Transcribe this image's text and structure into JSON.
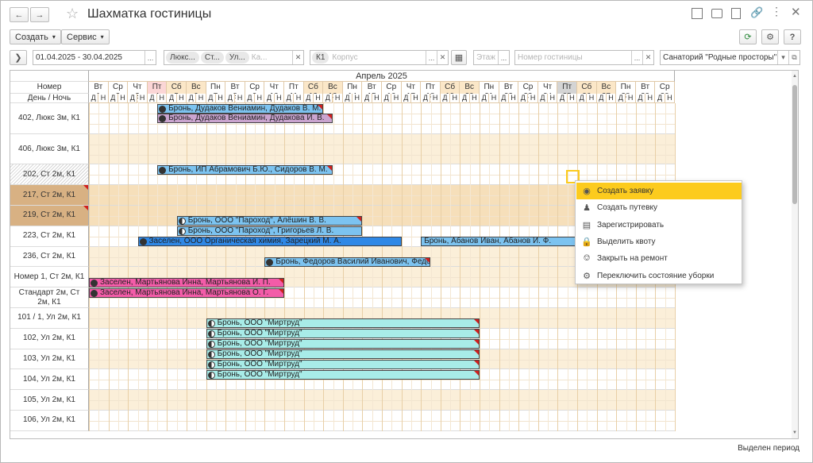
{
  "window": {
    "title": "Шахматка гостиницы"
  },
  "toolbar": {
    "create_label": "Создать",
    "service_label": "Сервис"
  },
  "filters": {
    "period": "01.04.2025 - 30.04.2025",
    "room_types": [
      "Люкс...",
      "Ст...",
      "Ул...",
      "Ка..."
    ],
    "building": {
      "value": "К1",
      "placeholder": "Корпус"
    },
    "floor_placeholder": "Этаж",
    "room_placeholder": "Номер гостиницы",
    "sanatorium": "Санаторий \"Родные просторы\""
  },
  "calendar": {
    "month": "Апрель 2025",
    "room_header": "Номер",
    "daynight_header": "День / Ночь",
    "day_letter": "Д",
    "night_letter": "Н",
    "days": [
      {
        "w": "Вт",
        "d": "1",
        "k": "n"
      },
      {
        "w": "Ср",
        "d": "2",
        "k": "n"
      },
      {
        "w": "Чт",
        "d": "3",
        "k": "n"
      },
      {
        "w": "Пт",
        "d": "4",
        "k": "h"
      },
      {
        "w": "Сб",
        "d": "5",
        "k": "we"
      },
      {
        "w": "Вс",
        "d": "6",
        "k": "we"
      },
      {
        "w": "Пн",
        "d": "7",
        "k": "n"
      },
      {
        "w": "Вт",
        "d": "8",
        "k": "n"
      },
      {
        "w": "Ср",
        "d": "9",
        "k": "n"
      },
      {
        "w": "Чт",
        "d": "10",
        "k": "n"
      },
      {
        "w": "Пт",
        "d": "11",
        "k": "n"
      },
      {
        "w": "Сб",
        "d": "12",
        "k": "we"
      },
      {
        "w": "Вс",
        "d": "13",
        "k": "we"
      },
      {
        "w": "Пн",
        "d": "14",
        "k": "n"
      },
      {
        "w": "Вт",
        "d": "15",
        "k": "n"
      },
      {
        "w": "Ср",
        "d": "16",
        "k": "n"
      },
      {
        "w": "Чт",
        "d": "17",
        "k": "n"
      },
      {
        "w": "Пт",
        "d": "18",
        "k": "n"
      },
      {
        "w": "Сб",
        "d": "19",
        "k": "we"
      },
      {
        "w": "Вс",
        "d": "20",
        "k": "we"
      },
      {
        "w": "Пн",
        "d": "21",
        "k": "n"
      },
      {
        "w": "Вт",
        "d": "22",
        "k": "n"
      },
      {
        "w": "Ср",
        "d": "23",
        "k": "n"
      },
      {
        "w": "Чт",
        "d": "24",
        "k": "n"
      },
      {
        "w": "Пт",
        "d": "25",
        "k": "sel"
      },
      {
        "w": "Сб",
        "d": "26",
        "k": "we"
      },
      {
        "w": "Вс",
        "d": "27",
        "k": "we"
      },
      {
        "w": "Пн",
        "d": "28",
        "k": "n"
      },
      {
        "w": "Вт",
        "d": "29",
        "k": "n"
      },
      {
        "w": "Ср",
        "d": "30",
        "k": "n"
      }
    ],
    "rooms": [
      {
        "name": "402, Люкс 3м, К1",
        "span": 3,
        "bg": "white"
      },
      {
        "name": "406, Люкс 3м, К1",
        "span": 3,
        "bg": "tan"
      },
      {
        "name": "202, Ст 2м, К1",
        "span": 2,
        "bg": "white",
        "hatched": true
      },
      {
        "name": "217, Ст 2м, К1",
        "span": 2,
        "bg": "tan",
        "blocked": true
      },
      {
        "name": "219, Ст 2м, К1",
        "span": 2,
        "bg": "tan",
        "blocked": true
      },
      {
        "name": "223, Ст 2м, К1",
        "span": 2,
        "bg": "white"
      },
      {
        "name": "236, Ст 2м, К1",
        "span": 2,
        "bg": "tan"
      },
      {
        "name": "Номер 1, Ст 2м, К1",
        "span": 2,
        "bg": "tan"
      },
      {
        "name": "Стандарт 2м, Ст 2м, К1",
        "span": 2,
        "bg": "white"
      },
      {
        "name": "101 / 1, Ул 2м, К1",
        "span": 2,
        "bg": "tan"
      },
      {
        "name": "102, Ул 2м, К1",
        "span": 2,
        "bg": "white"
      },
      {
        "name": "103, Ул 2м, К1",
        "span": 2,
        "bg": "tan"
      },
      {
        "name": "104, Ул 2м, К1",
        "span": 2,
        "bg": "white"
      },
      {
        "name": "105, Ул 2м, К1",
        "span": 2,
        "bg": "tan"
      },
      {
        "name": "106, Ул 2м, К1",
        "span": 2,
        "bg": "white"
      }
    ],
    "bookings": [
      {
        "text": "Бронь, Дудаков Вениамин, Дудаков В. М.",
        "lane": 0,
        "start": 7,
        "end": 24,
        "color": "#7cc3f0",
        "half": false,
        "flag": true
      },
      {
        "text": "Бронь, Дудаков Вениамин, Дудакова И. В.",
        "lane": 1,
        "start": 7,
        "end": 25,
        "color": "#caa4cf",
        "half": false,
        "flag": true
      },
      {
        "text": "Бронь, ИП Абрамович Б.Ю., Сидоров В. М.",
        "lane": 6,
        "start": 7,
        "end": 25,
        "color": "#7cc3f0",
        "half": false,
        "flag": true
      },
      {
        "text": "Бронь, ООО \"Пароход\", Алёшин В. В.",
        "lane": 11,
        "start": 9,
        "end": 28,
        "color": "#7cc3f0",
        "half": true,
        "flag": true
      },
      {
        "text": "Бронь, ООО \"Пароход\", Григорьев Л. В.",
        "lane": 12,
        "start": 9,
        "end": 28,
        "color": "#7cc3f0",
        "half": true,
        "flag": false
      },
      {
        "text": "Заселен, ООО Органическая химия, Зарецкий М. А.",
        "lane": 13,
        "start": 5,
        "end": 32,
        "color": "#2f88e6",
        "half": false,
        "flag": false
      },
      {
        "text": "Бронь, Абанов Иван, Абанов И. Ф.",
        "lane": 13,
        "start": 34,
        "end": 50,
        "color": "#7cc3f0",
        "half": false,
        "flag": false,
        "nodot": true
      },
      {
        "text": "Бронь, Федоров Василий Иванович, Федоров В. И.",
        "lane": 15,
        "start": 18,
        "end": 35,
        "color": "#7cc3f0",
        "half": false,
        "flag": true
      },
      {
        "text": "Заселен, Мартьянова Инна, Мартьянова И. П.",
        "lane": 17,
        "start": 0,
        "end": 20,
        "color": "#f35ca8",
        "half": false,
        "flag": true
      },
      {
        "text": "Заселен, Мартьянова Инна, Мартьянова О. Г.",
        "lane": 18,
        "start": 0,
        "end": 20,
        "color": "#f35ca8",
        "half": false,
        "flag": true
      },
      {
        "text": "Бронь, ООО \"Миртруд\"",
        "lane": 21,
        "start": 12,
        "end": 40,
        "color": "#a8ece8",
        "half": true,
        "flag": true
      },
      {
        "text": "Бронь, ООО \"Миртруд\"",
        "lane": 22,
        "start": 12,
        "end": 40,
        "color": "#a8ece8",
        "half": true,
        "flag": true
      },
      {
        "text": "Бронь, ООО \"Миртруд\"",
        "lane": 23,
        "start": 12,
        "end": 40,
        "color": "#a8ece8",
        "half": true,
        "flag": true
      },
      {
        "text": "Бронь, ООО \"Миртруд\"",
        "lane": 24,
        "start": 12,
        "end": 40,
        "color": "#a8ece8",
        "half": true,
        "flag": true
      },
      {
        "text": "Бронь, ООО \"Миртруд\"",
        "lane": 25,
        "start": 12,
        "end": 40,
        "color": "#a8ece8",
        "half": true,
        "flag": true
      },
      {
        "text": "Бронь, ООО \"Миртруд\"",
        "lane": 26,
        "start": 12,
        "end": 40,
        "color": "#a8ece8",
        "half": true,
        "flag": true
      }
    ]
  },
  "context_menu": [
    {
      "label": "Создать заявку",
      "icon": "pin-icon",
      "active": true
    },
    {
      "label": "Создать путевку",
      "icon": "person-icon"
    },
    {
      "label": "Зарегистрировать",
      "icon": "id-card-icon"
    },
    {
      "label": "Выделить квоту",
      "icon": "lock-icon"
    },
    {
      "label": "Закрыть на ремонт",
      "icon": "paint-roller-icon"
    },
    {
      "label": "Переключить состояние уборки",
      "icon": "broom-icon"
    }
  ],
  "status": {
    "text": "Выделен период"
  },
  "colors": {
    "accent": "#fccb1e",
    "weekend": "#fbe7c8",
    "holiday": "#fbd6d6",
    "blocked": "#d8b183"
  }
}
